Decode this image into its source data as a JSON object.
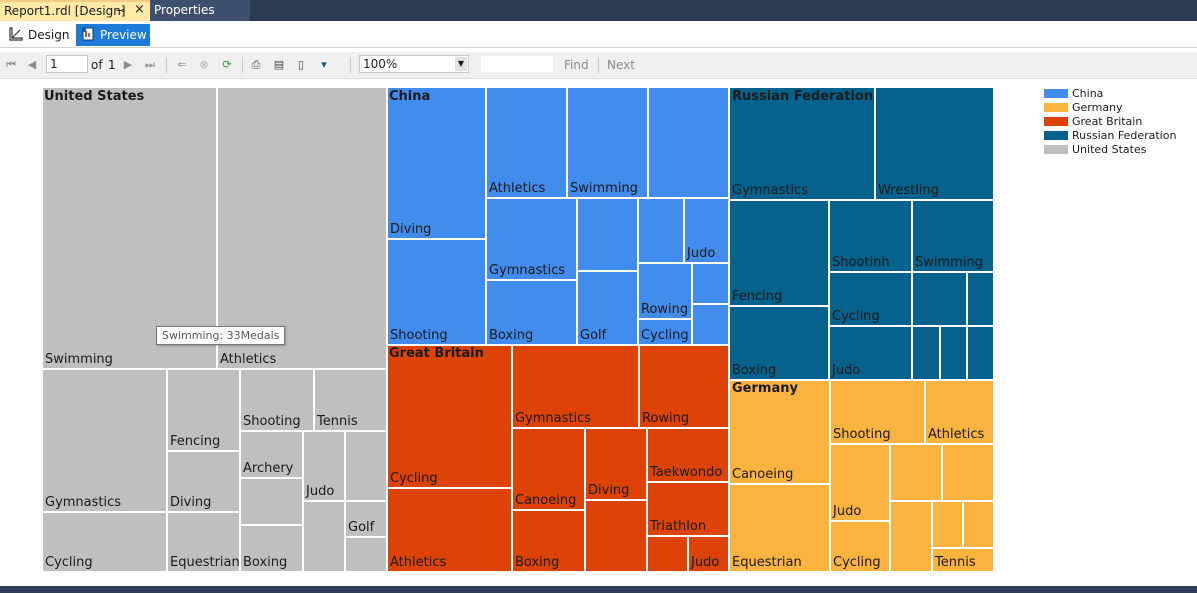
{
  "tabs": {
    "active_label": "Report1.rdl [Design]",
    "properties_label": "Properties"
  },
  "subtabs": {
    "design_label": "Design",
    "preview_label": "Preview"
  },
  "toolbar": {
    "page_value": "1",
    "page_of": "of",
    "page_total": "1",
    "zoom_value": "100%",
    "find_label": "Find",
    "next_label": "Next"
  },
  "colors": {
    "china": "#418ced",
    "germany": "#fbb340",
    "great_britain": "#dd4306",
    "russian_federation": "#06628d",
    "united_states": "#bfbfbf"
  },
  "chart_data": {
    "type": "treemap",
    "metric": "Medals",
    "legend": [
      "China",
      "Germany",
      "Great Britain",
      "Russian Federation",
      "United States"
    ],
    "legend_position": "top-right",
    "tooltip": "Swimming: 33Medals",
    "groups": [
      {
        "name": "United States",
        "labeled_sports": [
          "Swimming",
          "Athletics",
          "Gymnastics",
          "Fencing",
          "Shooting",
          "Tennis",
          "Archery",
          "Judo",
          "Diving",
          "Golf",
          "Cycling",
          "Equestrian",
          "Boxing"
        ],
        "highlighted": {
          "sport": "Swimming",
          "medals": 33
        }
      },
      {
        "name": "China",
        "labeled_sports": [
          "Athletics",
          "Swimming",
          "Diving",
          "Gymnastics",
          "Judo",
          "Rowing",
          "Shooting",
          "Boxing",
          "Golf",
          "Cycling"
        ]
      },
      {
        "name": "Russian Federation",
        "labeled_sports": [
          "Gymnastics",
          "Wrestling",
          "Shootinh",
          "Swimming",
          "Fencing",
          "Cycling",
          "Boxing",
          "Judo"
        ]
      },
      {
        "name": "Great Britain",
        "labeled_sports": [
          "Gymnastics",
          "Rowing",
          "Cycling",
          "Taekwondo",
          "Canoeing",
          "Diving",
          "Triathlon",
          "Athletics",
          "Boxing",
          "Judo"
        ]
      },
      {
        "name": "Germany",
        "labeled_sports": [
          "Shooting",
          "Athletics",
          "Canoeing",
          "Judo",
          "Equestrian",
          "Cycling",
          "Tennis"
        ]
      }
    ]
  }
}
